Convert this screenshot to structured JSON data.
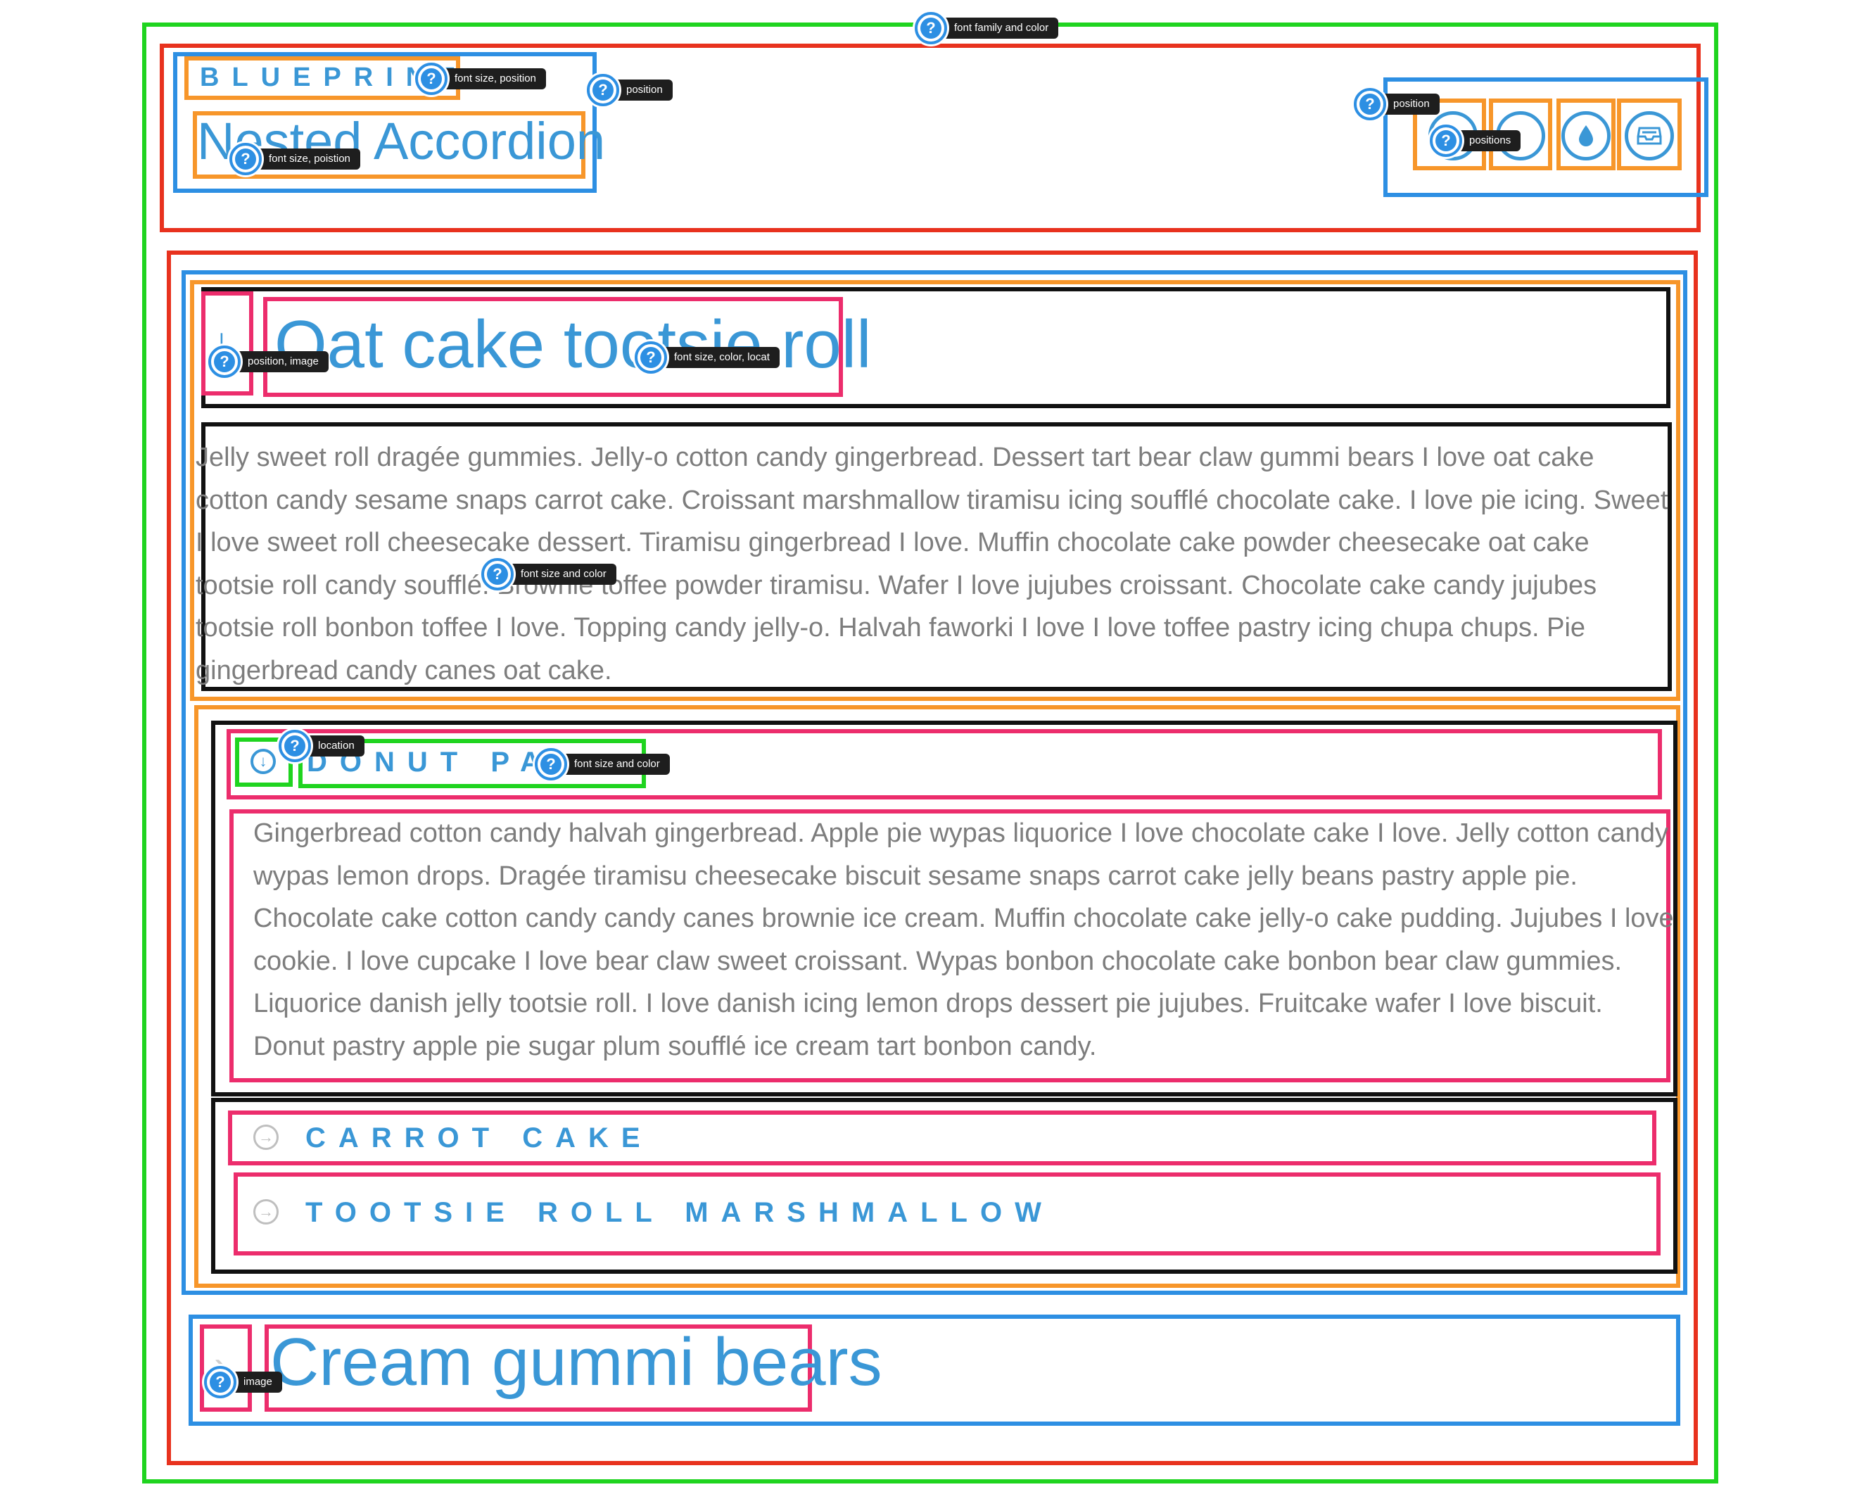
{
  "header": {
    "brand": "BLUEPRINT",
    "title": "Nested Accordion",
    "icons": [
      "circle-icon",
      "circle-icon",
      "water-drop-icon",
      "inbox-icon"
    ]
  },
  "annotations": {
    "font_family_color": "font family and color",
    "brand_font": "font size, position",
    "brand_position": "position",
    "title_font": "font size, poistion",
    "icons_position": "position",
    "icons_positions": "positions",
    "panel1_icon": "position, image",
    "panel1_title": "font size, color, locat",
    "panel1_body": "font size and color",
    "sub1_icon": "location",
    "sub1_title": "font size and color",
    "panel2_icon": "image"
  },
  "accordion": {
    "panel1": {
      "title": "Oat cake tootsie roll",
      "body": "Jelly sweet roll dragée gummies. Jelly-o cotton candy gingerbread. Dessert tart bear claw gummi bears I love oat cake cotton candy sesame snaps carrot cake. Croissant marshmallow tiramisu icing soufflé chocolate cake. I love pie icing. Sweet I love sweet roll cheesecake dessert. Tiramisu gingerbread I love. Muffin chocolate cake powder cheesecake oat cake tootsie roll candy soufflé. Brownie toffee powder tiramisu. Wafer I love jujubes croissant. Chocolate cake candy jujubes tootsie roll bonbon toffee I love. Topping candy jelly-o. Halvah faworki I love I love toffee pastry icing chupa chups. Pie gingerbread candy canes oat cake."
    },
    "sub1": {
      "title": "DONUT PA",
      "body": "Gingerbread cotton candy halvah gingerbread. Apple pie wypas liquorice I love chocolate cake I love. Jelly cotton candy wypas lemon drops. Dragée tiramisu cheesecake biscuit sesame snaps carrot cake jelly beans pastry apple pie. Chocolate cake cotton candy candy canes brownie ice cream. Muffin chocolate cake jelly-o cake pudding. Jujubes I love cookie. I love cupcake I love bear claw sweet croissant. Wypas bonbon chocolate cake bonbon bear claw gummies. Liquorice danish jelly tootsie roll. I love danish icing lemon drops dessert pie jujubes. Fruitcake wafer I love biscuit. Donut pastry apple pie sugar plum soufflé ice cream tart bonbon candy."
    },
    "sub2": {
      "title": "CARROT CAKE"
    },
    "sub3": {
      "title": "TOOTSIE ROLL MARSHMALLOW"
    },
    "panel2": {
      "title": "Cream gummi bears"
    }
  },
  "colors": {
    "accent": "#3a97d6",
    "body_text": "#7d7d7d",
    "outline_green": "#1fd41f",
    "outline_red": "#e8321e",
    "outline_blue": "#2d8fe3",
    "outline_orange": "#f7962a",
    "outline_black": "#111111",
    "outline_pink": "#ec2d6c"
  }
}
